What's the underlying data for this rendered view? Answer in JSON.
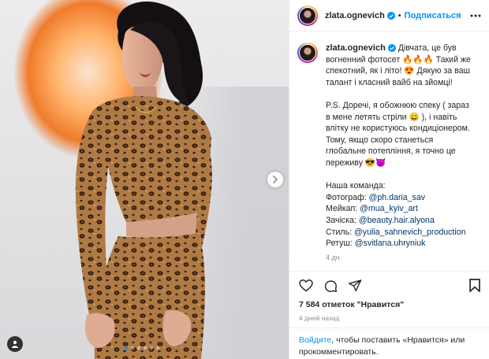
{
  "post": {
    "username": "zlata.ognevich",
    "separator": "•",
    "follow_label": "Подписаться",
    "caption_line1": "Дівчата, це був вогненний фотосет 🔥🔥🔥 Такий же спекотний, як і літо! 😍 Дякую за ваш талант і класний вайб на зйомці!",
    "caption_ps": "P.S. Доречі, я обожнюю спеку ( зараз в мене летять стріли 😄 ), і навіть влітку не користуюсь кондиціонером. Тому, якщо скоро станеться глобальне потепління, я точно це переживу 😎😈",
    "team_title": "Наша команда:",
    "credits": [
      {
        "role": "Фотограф: ",
        "handle": "@ph.daria_sav"
      },
      {
        "role": "Мейкап: ",
        "handle": "@mua_kyiv_art"
      },
      {
        "role": "Зачіска: ",
        "handle": "@beauty.hair.alyona"
      },
      {
        "role": "Стиль: ",
        "handle": "@yulia_sahnevich_production"
      },
      {
        "role": "Ретуш: ",
        "handle": "@svitlana.uhryniuk"
      }
    ],
    "caption_age": "4 дн.",
    "likes_text": "7 584 отметок \"Нравится\"",
    "posted_ago": "4 дней назад",
    "login_link": "Войдите",
    "login_rest": ", чтобы поставить «Нравится» или прокомментировать."
  },
  "carousel": {
    "slide_count": 6,
    "active_index": 0
  },
  "icons": {
    "verified": "verified-badge-icon",
    "more": "more-horizontal-icon",
    "like": "heart-icon",
    "comment": "comment-bubble-icon",
    "share": "paper-plane-icon",
    "save": "bookmark-icon",
    "next": "chevron-right-icon",
    "tags": "user-tag-icon"
  },
  "colors": {
    "accent": "#0095f6",
    "link": "#00376b",
    "muted": "#8e8e8e",
    "text": "#262626"
  }
}
